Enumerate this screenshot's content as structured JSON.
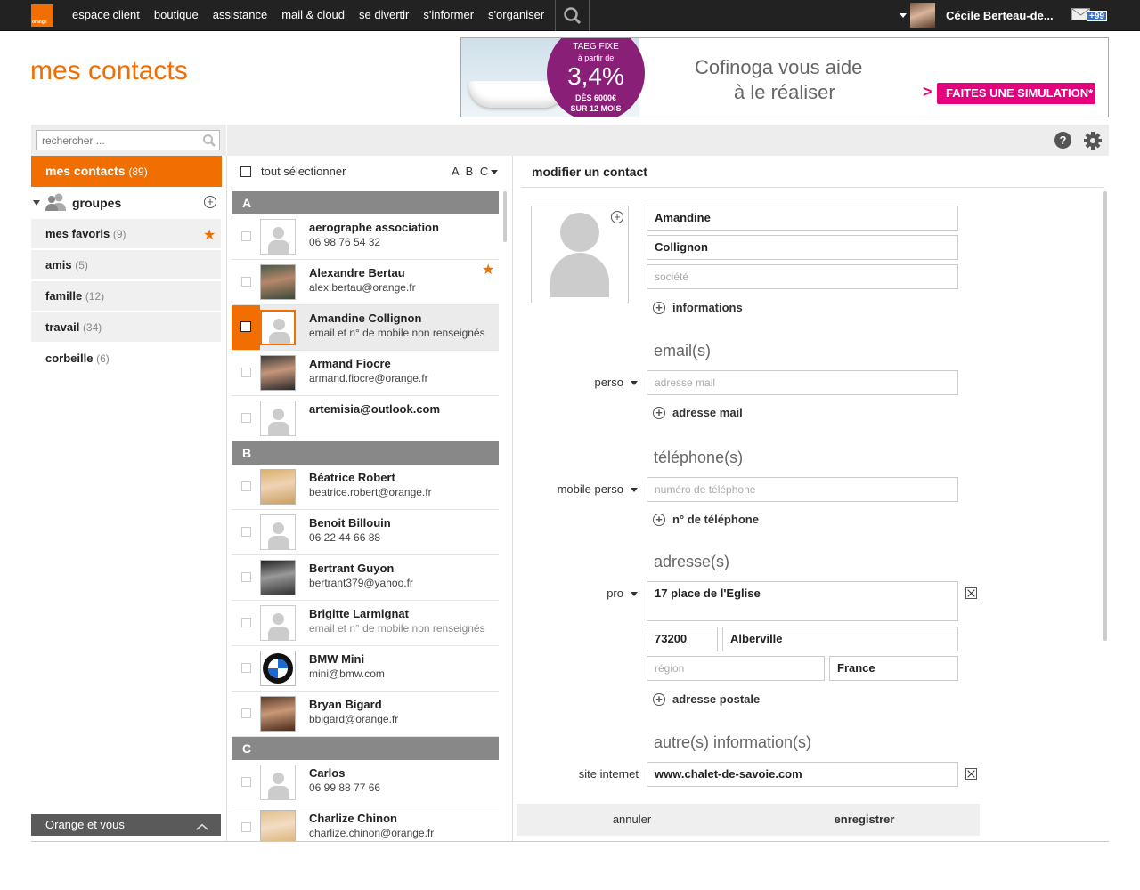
{
  "topbar": {
    "logo_text": "orange",
    "nav": [
      "espace client",
      "boutique",
      "assistance",
      "mail & cloud",
      "se divertir",
      "s'informer",
      "s'organiser"
    ],
    "user_name": "Cécile Berteau-de...",
    "mail_badge": "+99"
  },
  "page_title": "mes contacts",
  "ad": {
    "circle_line1": "TAEG FIXE",
    "circle_line2": "à partir de",
    "rate": "3,4%",
    "circle_line4": "DÈS 6000€",
    "circle_line5": "SUR 12 MOIS",
    "headline1": "Cofinoga vous aide",
    "headline2": "à le réaliser",
    "cta": "FAITES UNE SIMULATION*"
  },
  "toolbar": {
    "search_placeholder": "rechercher ..."
  },
  "sidebar": {
    "all_label": "mes contacts",
    "all_count": "(89)",
    "groups_label": "groupes",
    "items": [
      {
        "label": "mes favoris",
        "count": "(9)"
      },
      {
        "label": "amis",
        "count": "(5)"
      },
      {
        "label": "famille",
        "count": "(12)"
      },
      {
        "label": "travail",
        "count": "(34)"
      },
      {
        "label": "corbeille",
        "count": "(6)"
      }
    ],
    "footer": "Orange et vous"
  },
  "list": {
    "select_all": "tout sélectionner",
    "sort": "A B C",
    "letters": [
      "A",
      "B",
      "C"
    ],
    "contacts": [
      {
        "name": "aerographe association",
        "sub": "06 98 76 54 32"
      },
      {
        "name": "Alexandre Bertau",
        "sub": "alex.bertau@orange.fr"
      },
      {
        "name": "Amandine Collignon",
        "sub": "email et n° de mobile non renseignés"
      },
      {
        "name": "Armand Fiocre",
        "sub": "armand.fiocre@orange.fr"
      },
      {
        "name": "artemisia@outlook.com",
        "sub": ""
      },
      {
        "name": "Béatrice Robert",
        "sub": "beatrice.robert@orange.fr"
      },
      {
        "name": "Benoit Billouin",
        "sub": "06 22 44 66 88"
      },
      {
        "name": "Bertrant Guyon",
        "sub": "bertrant379@yahoo.fr"
      },
      {
        "name": "Brigitte Larmignat",
        "sub": "email et n° de mobile non renseignés"
      },
      {
        "name": "BMW Mini",
        "sub": "mini@bmw.com"
      },
      {
        "name": "Bryan Bigard",
        "sub": "bbigard@orange.fr"
      },
      {
        "name": "Carlos",
        "sub": "06 99 88 77 66"
      },
      {
        "name": "Charlize Chinon",
        "sub": "charlize.chinon@orange.fr"
      }
    ]
  },
  "form": {
    "title": "modifier un contact",
    "first_name": "Amandine",
    "last_name": "Collignon",
    "company_placeholder": "société",
    "add_info": "informations",
    "email_section": "email(s)",
    "email_type": "perso",
    "email_placeholder": "adresse mail",
    "add_email": "adresse mail",
    "phone_section": "téléphone(s)",
    "phone_type": "mobile perso",
    "phone_placeholder": "numéro de téléphone",
    "add_phone": "n° de téléphone",
    "address_section": "adresse(s)",
    "address_type": "pro",
    "street": "17 place de l'Eglise",
    "postcode": "73200",
    "city": "Alberville",
    "region_placeholder": "région",
    "country": "France",
    "add_address": "adresse postale",
    "other_section": "autre(s) information(s)",
    "website_label": "site internet",
    "website": "www.chalet-de-savoie.com",
    "cancel": "annuler",
    "save": "enregistrer"
  },
  "colors": {
    "accent": "#f16e00",
    "ad_purple": "#8a1f78",
    "ad_pink": "#e5007e"
  }
}
